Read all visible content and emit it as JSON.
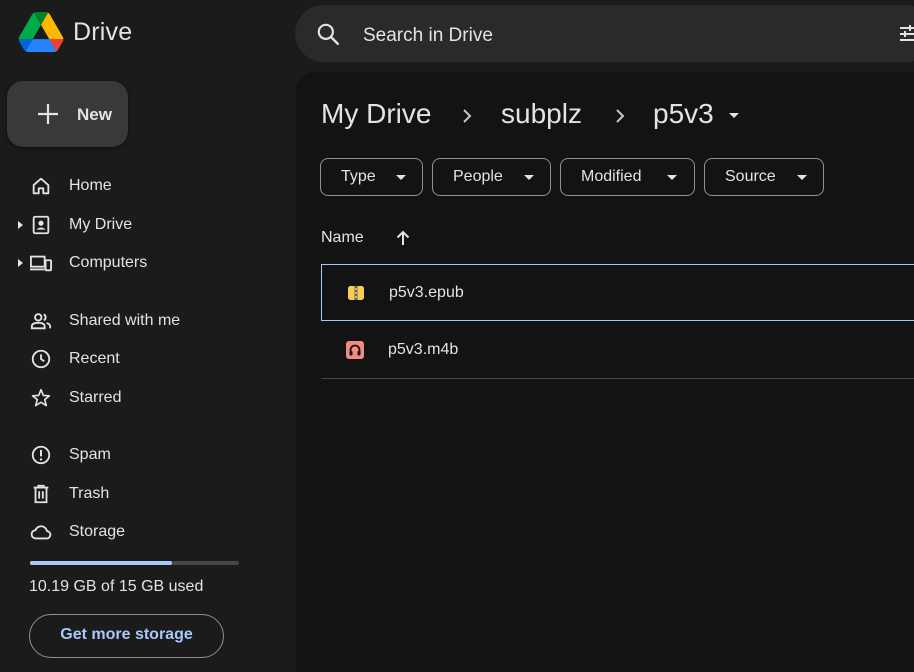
{
  "app": {
    "name": "Drive"
  },
  "search": {
    "placeholder": "Search in Drive"
  },
  "new_button": {
    "label": "New"
  },
  "sidebar": {
    "items": [
      {
        "label": "Home"
      },
      {
        "label": "My Drive"
      },
      {
        "label": "Computers"
      },
      {
        "label": "Shared with me"
      },
      {
        "label": "Recent"
      },
      {
        "label": "Starred"
      },
      {
        "label": "Spam"
      },
      {
        "label": "Trash"
      },
      {
        "label": "Storage"
      }
    ]
  },
  "storage": {
    "used_text": "10.19 GB of 15 GB used",
    "used_fraction": 0.679,
    "button_label": "Get more storage"
  },
  "breadcrumb": [
    "My Drive",
    "subplz",
    "p5v3"
  ],
  "filters": [
    "Type",
    "People",
    "Modified",
    "Source"
  ],
  "file_list": {
    "column_name": "Name",
    "files": [
      {
        "name": "p5v3.epub",
        "icon": "archive-file-icon",
        "selected": true
      },
      {
        "name": "p5v3.m4b",
        "icon": "audio-file-icon",
        "selected": false
      }
    ]
  },
  "colors": {
    "accent": "#a8c7fa",
    "background": "#1b1b1b",
    "content_background": "#131314",
    "archive_icon": "#f9cc55",
    "audio_icon": "#f28b82"
  }
}
